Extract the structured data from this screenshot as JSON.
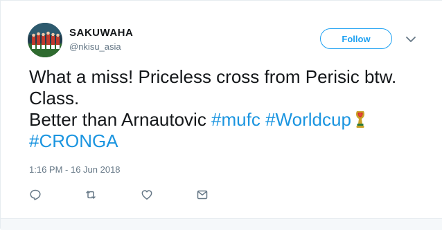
{
  "user": {
    "display_name": "SAKUWAHA",
    "handle": "@nkisu_asia"
  },
  "follow_button": {
    "label": "Follow"
  },
  "tweet": {
    "line1": "What a miss! Priceless cross from Perisic btw.",
    "line2": "Class.",
    "line3_text": "Better than Arnautovic ",
    "hashtags_line3": [
      "#mufc",
      "#Worldcup"
    ],
    "hashtag_line4": "#CRONGA",
    "emoji": "world-cup-trophy-icon"
  },
  "timestamp": "1:16 PM - 16 Jun 2018",
  "actions": [
    "reply-icon",
    "retweet-icon",
    "like-icon",
    "direct-message-icon"
  ],
  "colors": {
    "accent": "#1da1f2",
    "hashtag": "#1b95e0",
    "text": "#14171a",
    "secondary_text": "#657786",
    "border": "#e6ecf0"
  }
}
